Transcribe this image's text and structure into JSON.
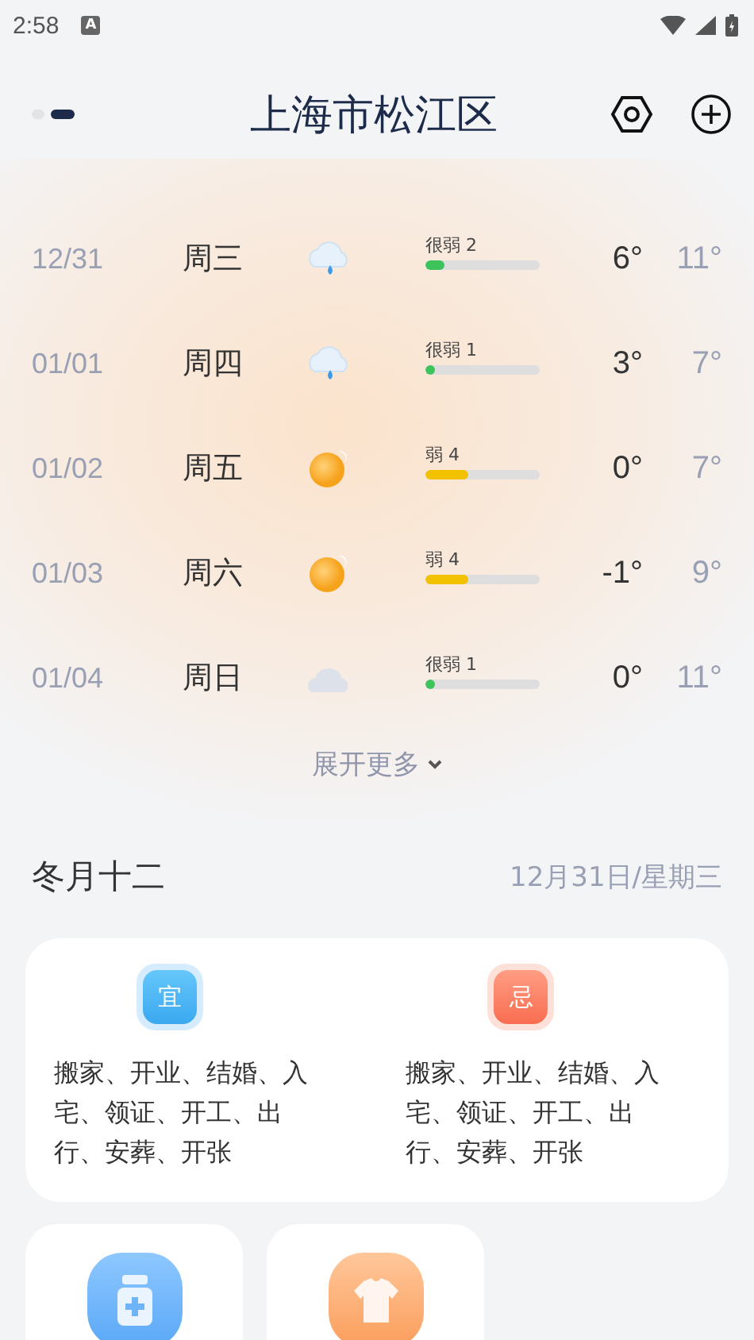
{
  "status_bar": {
    "time": "2:58",
    "notification": "A"
  },
  "header": {
    "title": "上海市松江区",
    "pages": [
      {
        "selected": false
      },
      {
        "selected": true
      }
    ]
  },
  "forecast": [
    {
      "date": "12/31",
      "weekday": "周三",
      "kind": "rain",
      "aqi": "很弱 2",
      "level": 0.17,
      "color": "#3cc35c",
      "low": "6°",
      "high": "11°"
    },
    {
      "date": "01/01",
      "weekday": "周四",
      "kind": "rain",
      "aqi": "很弱 1",
      "level": 0.06,
      "color": "#3cc35c",
      "low": "3°",
      "high": "7°"
    },
    {
      "date": "01/02",
      "weekday": "周五",
      "kind": "sun",
      "aqi": "弱 4",
      "level": 0.37,
      "color": "#f2c200",
      "low": "0°",
      "high": "7°"
    },
    {
      "date": "01/03",
      "weekday": "周六",
      "kind": "sun",
      "aqi": "弱 4",
      "level": 0.37,
      "color": "#f2c200",
      "low": "-1°",
      "high": "9°"
    },
    {
      "date": "01/04",
      "weekday": "周日",
      "kind": "cloud",
      "aqi": "很弱 1",
      "level": 0.06,
      "color": "#3cc35c",
      "low": "0°",
      "high": "11°"
    }
  ],
  "expand_more": "展开更多",
  "almanac": {
    "lunar_date": "冬月十二",
    "date": "12月31日/星期三",
    "columns": [
      {
        "kind": "good",
        "badge": "宜",
        "text": "搬家、开业、结婚、入宅、领证、开工、出行、安葬、开张"
      },
      {
        "kind": "bad",
        "badge": "忌",
        "text": "搬家、开业、结婚、入宅、领证、开工、出行、安葬、开张"
      }
    ]
  },
  "tiles": [
    {
      "kind": "medicine"
    },
    {
      "kind": "clothing"
    }
  ]
}
